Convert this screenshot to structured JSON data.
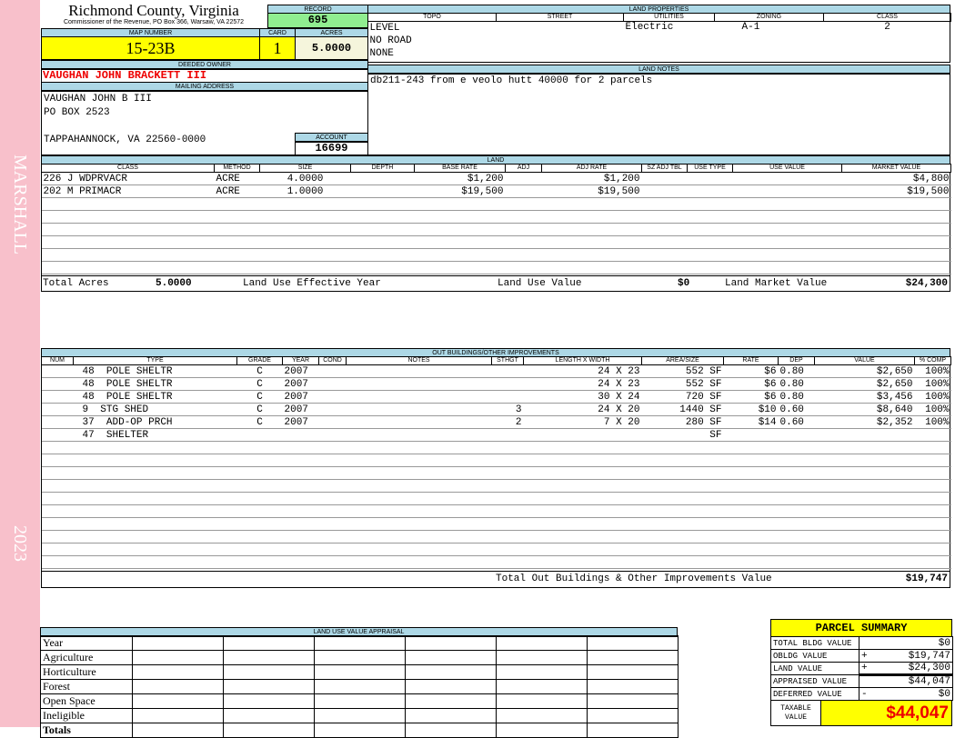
{
  "side": {
    "name": "MARSHALL",
    "year": "2023"
  },
  "header": {
    "title": "Richmond County, Virginia",
    "subtitle": "Commissioner of the Revenue, PO Box 366, Warsaw, VA 22572",
    "record_label": "RECORD",
    "record": "695",
    "map_label": "MAP NUMBER",
    "map": "15-23B",
    "card_label": "CARD",
    "card": "1",
    "acres_label": "ACRES",
    "acres": "5.0000"
  },
  "owner": {
    "deeded_label": "DEEDED OWNER",
    "deeded": "VAUGHAN JOHN BRACKETT III",
    "mailing_label": "MAILING ADDRESS",
    "address": [
      "VAUGHAN JOHN B III",
      "PO BOX 2523",
      "",
      "TAPPAHANNOCK, VA 22560-0000"
    ],
    "account_label": "ACCOUNT",
    "account": "16699"
  },
  "land_properties": {
    "label": "LAND PROPERTIES",
    "columns": [
      "TOPO",
      "STREET",
      "UTILITIES",
      "ZONING",
      "CLASS"
    ],
    "topo": [
      "LEVEL",
      "NO ROAD",
      "NONE"
    ],
    "utilities": "Electric",
    "zoning": "A-1",
    "class": "2"
  },
  "land_notes": {
    "label": "LAND NOTES",
    "text": "db211-243 from e veolo hutt 40000 for 2 parcels"
  },
  "land": {
    "label": "LAND",
    "columns": [
      "CLASS",
      "METHOD",
      "SIZE",
      "DEPTH",
      "BASE RATE",
      "ADJ",
      "ADJ RATE",
      "SZ ADJ TBL",
      "USE TYPE",
      "USE VALUE",
      "MARKET VALUE"
    ],
    "rows": [
      [
        "226 J WDPRVACR",
        "ACRE",
        "4.0000",
        "",
        "$1,200",
        "",
        "$1,200",
        "",
        "",
        "",
        "$4,800"
      ],
      [
        "202 M PRIMACR",
        "ACRE",
        "1.0000",
        "",
        "$19,500",
        "",
        "$19,500",
        "",
        "",
        "",
        "$19,500"
      ]
    ],
    "total_acres_label": "Total Acres",
    "total_acres": "5.0000",
    "effective_year_label": "Land Use Effective Year",
    "use_value_label": "Land Use Value",
    "use_value": "$0",
    "market_value_label": "Land Market Value",
    "market_value": "$24,300"
  },
  "outbuildings": {
    "label": "OUT BUILDINGS/OTHER IMPROVEMENTS",
    "columns": [
      "NUM",
      "TYPE",
      "GRADE",
      "YEAR",
      "COND",
      "NOTES",
      "STHGT",
      "LENGTH X WIDTH",
      "AREA/SIZE",
      "RATE",
      "DEP",
      "VALUE",
      "% COMP"
    ],
    "rows": [
      [
        "",
        "48  POLE SHELTR",
        "C",
        "2007",
        "",
        "",
        "",
        "24 X 23",
        "552 SF",
        "$6",
        "0.80",
        "$2,650",
        "100%"
      ],
      [
        "",
        "48  POLE SHELTR",
        "C",
        "2007",
        "",
        "",
        "",
        "24 X 23",
        "552 SF",
        "$6",
        "0.80",
        "$2,650",
        "100%"
      ],
      [
        "",
        "48  POLE SHELTR",
        "C",
        "2007",
        "",
        "",
        "",
        "30 X 24",
        "720 SF",
        "$6",
        "0.80",
        "$3,456",
        "100%"
      ],
      [
        "",
        "9  STG SHED",
        "C",
        "2007",
        "",
        "",
        "3",
        "24 X 20",
        "1440 SF",
        "$10",
        "0.60",
        "$8,640",
        "100%"
      ],
      [
        "",
        "37  ADD-OP PRCH",
        "C",
        "2007",
        "",
        "",
        "2",
        "7 X 20",
        "280 SF",
        "$14",
        "0.60",
        "$2,352",
        "100%"
      ],
      [
        "",
        "47  SHELTER",
        "",
        "",
        "",
        "",
        "",
        "",
        "SF",
        "",
        "",
        "",
        ""
      ]
    ],
    "total_label": "Total Out Buildings & Other Improvements Value",
    "total": "$19,747"
  },
  "land_use": {
    "label": "LAND USE VALUE APPRAISAL",
    "rows": [
      "Year",
      "Agriculture",
      "Horticulture",
      "Forest",
      "Open Space",
      "Ineligible",
      "Totals"
    ]
  },
  "summary": {
    "label": "PARCEL SUMMARY",
    "rows": [
      {
        "label": "TOTAL BLDG VALUE",
        "op": "",
        "value": "$0"
      },
      {
        "label": "OBLDG VALUE",
        "op": "+",
        "value": "$19,747"
      },
      {
        "label": "LAND VALUE",
        "op": "+",
        "value": "$24,300"
      },
      {
        "label": "APPRAISED VALUE",
        "op": "",
        "value": "$44,047"
      },
      {
        "label": "DEFERRED VALUE",
        "op": "-",
        "value": "$0"
      }
    ],
    "taxable_label": "TAXABLE VALUE",
    "taxable": "$44,047"
  }
}
